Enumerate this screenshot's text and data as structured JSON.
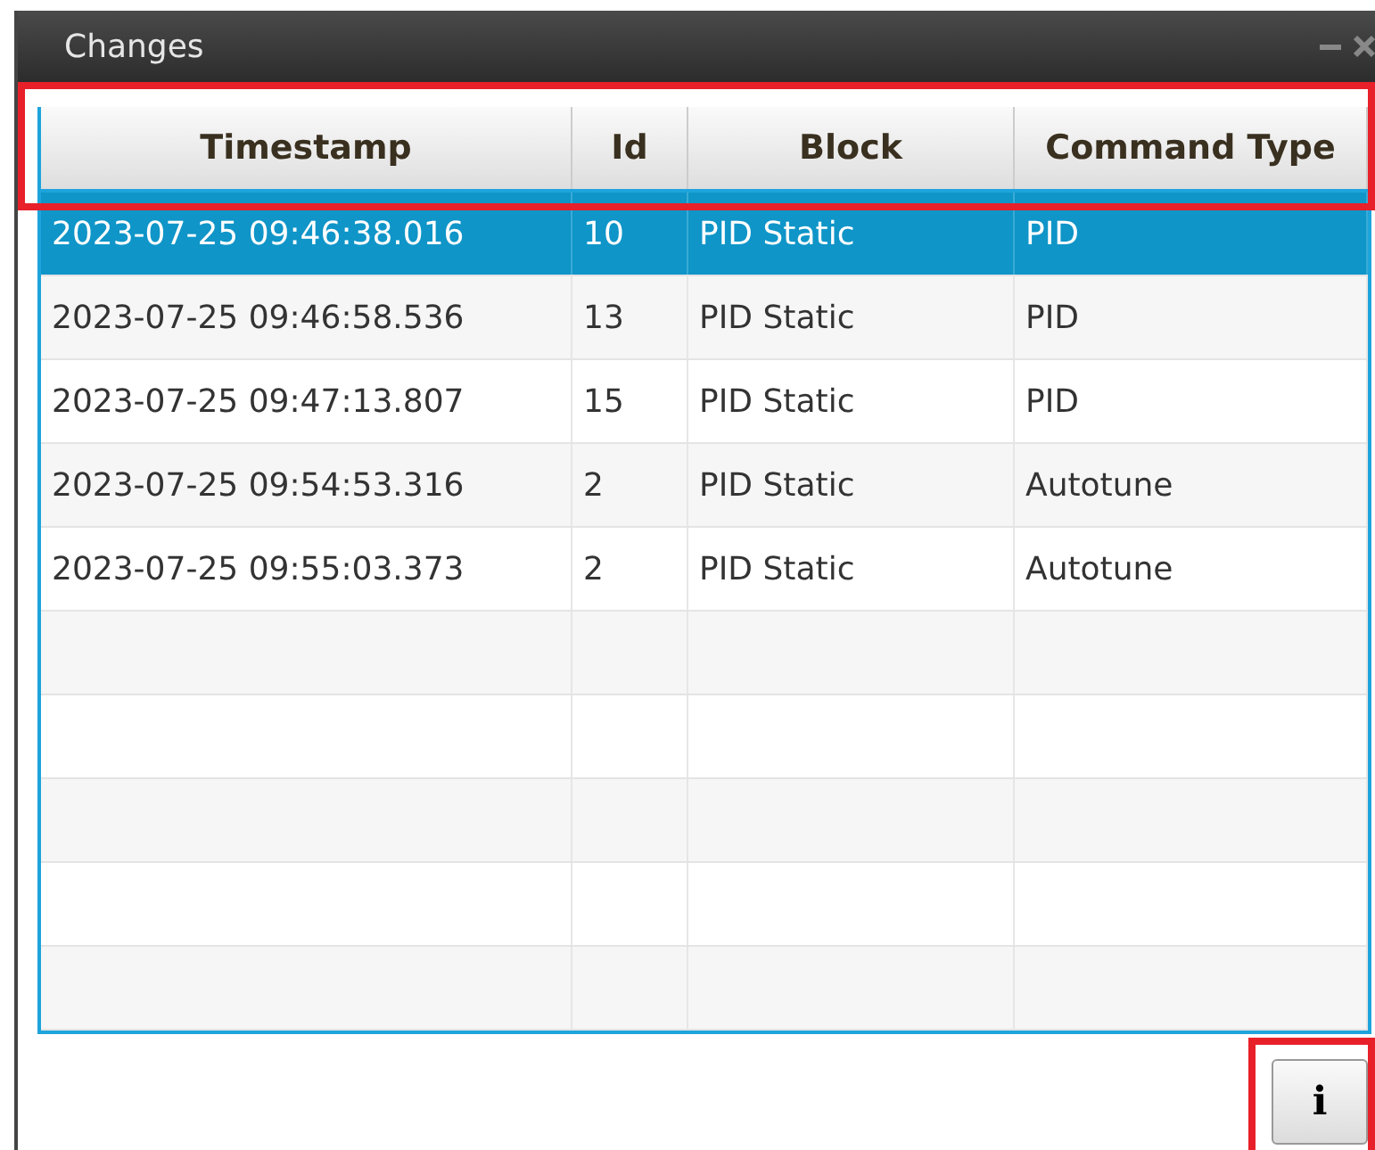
{
  "window": {
    "title": "Changes"
  },
  "table": {
    "columns": [
      "Timestamp",
      "Id",
      "Block",
      "Command Type"
    ],
    "rows": [
      {
        "cells": [
          "2023-07-25 09:46:38.016",
          "10",
          "PID Static",
          "PID"
        ],
        "selected": true
      },
      {
        "cells": [
          "2023-07-25 09:46:58.536",
          "13",
          "PID Static",
          "PID"
        ],
        "selected": false
      },
      {
        "cells": [
          "2023-07-25 09:47:13.807",
          "15",
          "PID Static",
          "PID"
        ],
        "selected": false
      },
      {
        "cells": [
          "2023-07-25 09:54:53.316",
          "2",
          "PID Static",
          "Autotune"
        ],
        "selected": false
      },
      {
        "cells": [
          "2023-07-25 09:55:03.373",
          "2",
          "PID Static",
          "Autotune"
        ],
        "selected": false
      }
    ]
  },
  "info_button": {
    "label": "i"
  }
}
